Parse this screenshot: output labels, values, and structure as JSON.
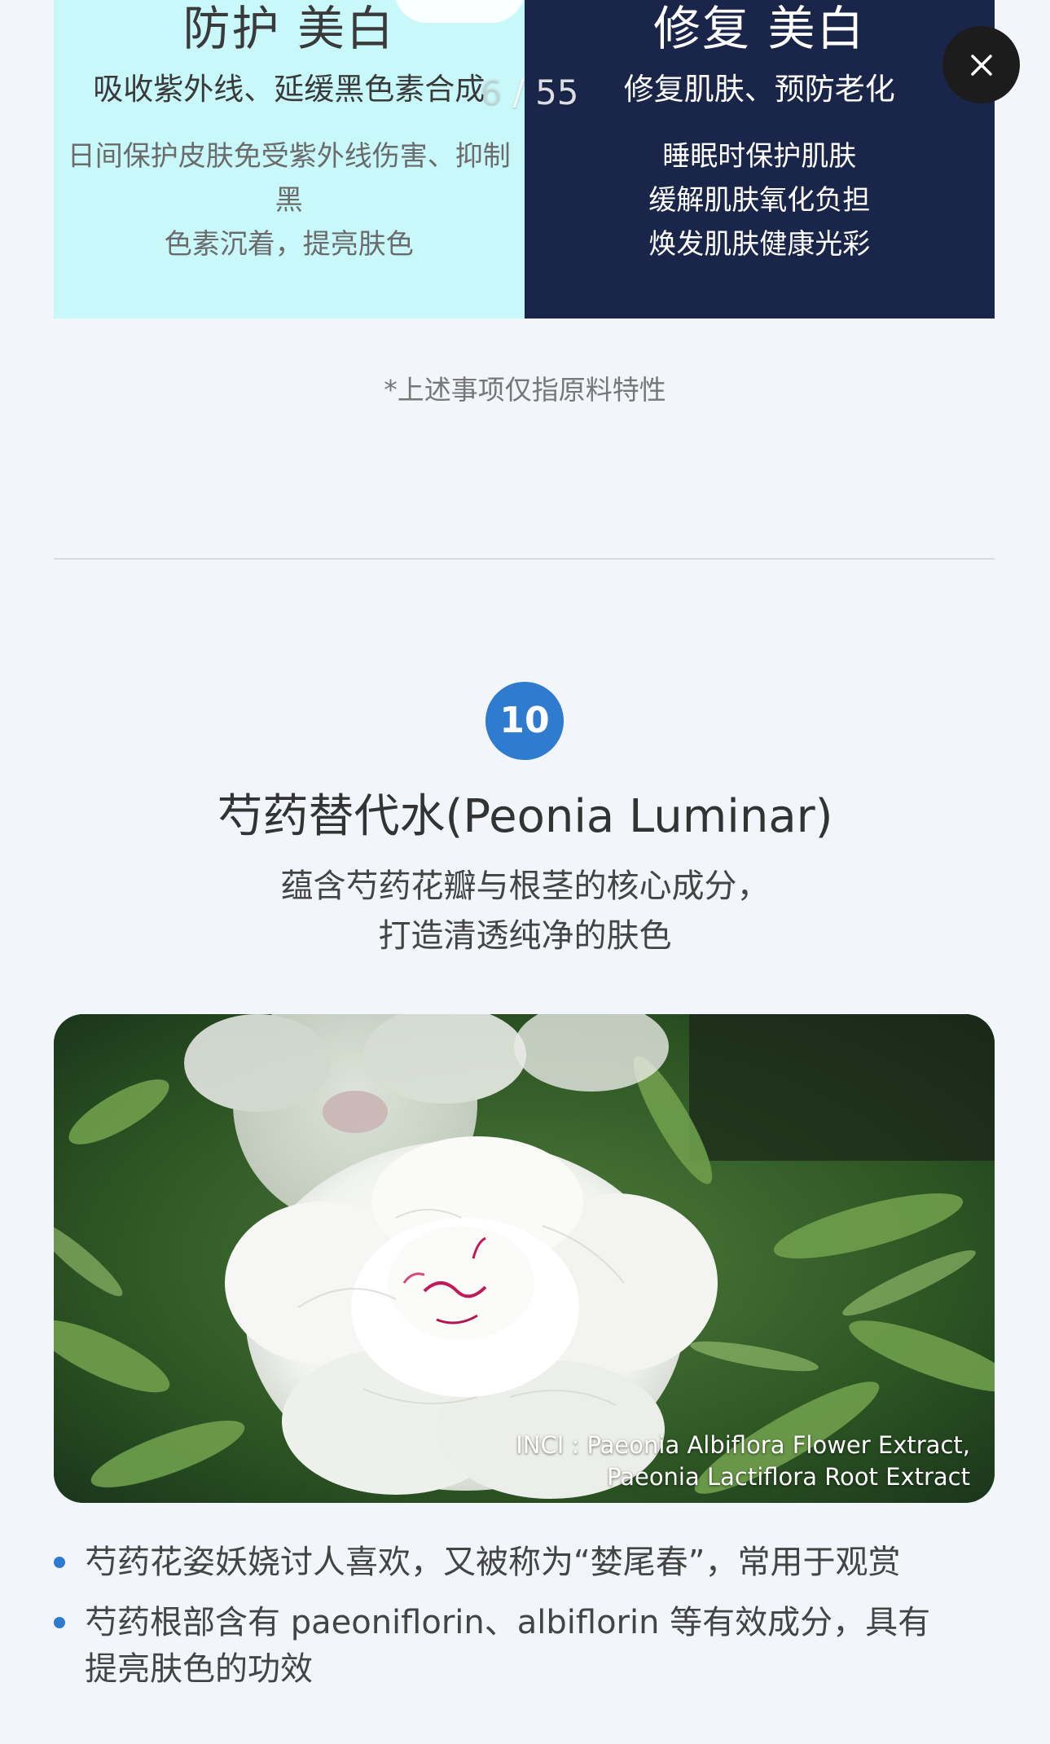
{
  "left_panel": {
    "title": "防护 美白",
    "subtitle": "吸收紫外线、延缓黑色素合成",
    "desc_lines": [
      "日间保护皮肤免受紫外线伤害、抑制黑",
      "色素沉着，提亮肤色"
    ]
  },
  "right_panel": {
    "title": "修复 美白",
    "subtitle": "修复肌肤、预防老化",
    "desc_lines": [
      "睡眠时保护肌肤",
      "缓解肌肤氧化负担",
      "焕发肌肤健康光彩"
    ]
  },
  "viewer": {
    "current_page": "6",
    "separator": " / ",
    "total_pages": "55",
    "close_icon": "close-icon"
  },
  "footnote": "*上述事项仅指原料特性",
  "ingredient": {
    "number": "10",
    "title": "芍药替代水(Peonia Luminar)",
    "desc_lines": [
      "蕴含芍药花瓣与根茎的核心成分，",
      "打造清透纯净的肤色"
    ],
    "photo_caption_lines": [
      "INCI : Paeonia Albiflora Flower Extract,",
      "Paeonia Lactiflora Root Extract"
    ]
  },
  "bullets": [
    {
      "lines": [
        "芍药花姿妖娆讨人喜欢，又被称为“婪尾春”，常用于观赏"
      ]
    },
    {
      "lines": [
        "芍药根部含有 paeoniflorin、albiflorin 等有效成分，具有",
        "提亮肤色的功效"
      ]
    }
  ],
  "colors": {
    "page_bg": "#f2f5f9",
    "left_panel_bg": "#c9f8fb",
    "right_panel_bg": "#1a2649",
    "accent": "#2e7bd0",
    "close_bg": "#1c1c1c"
  }
}
